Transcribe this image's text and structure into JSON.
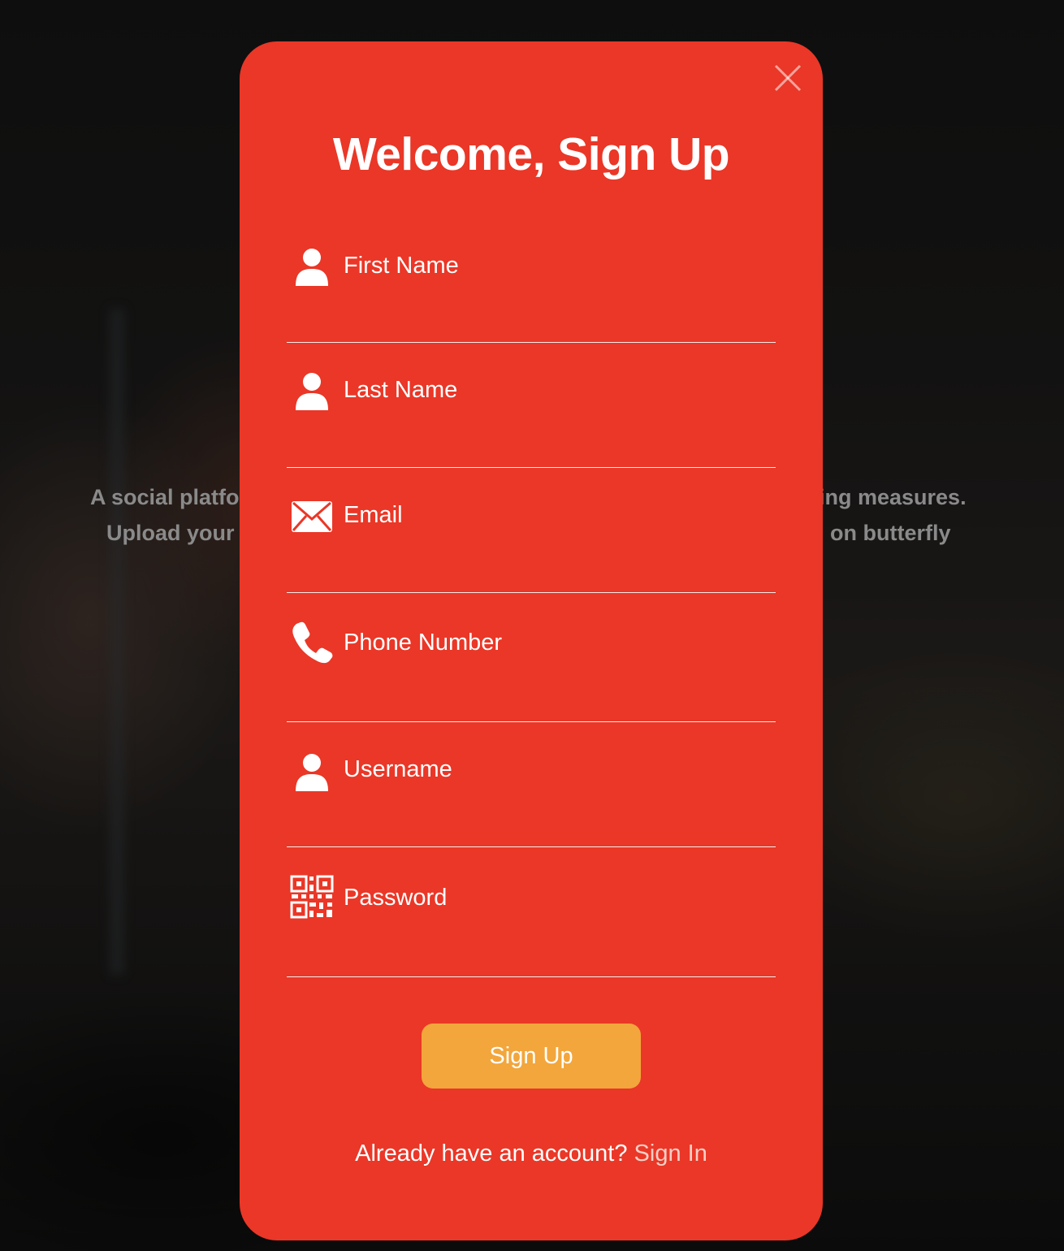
{
  "background": {
    "tagline_line1_left": "A social platfo",
    "tagline_line1_right": "ing measures.",
    "tagline_line2_left": "Upload your",
    "tagline_line2_right": "on butterfly"
  },
  "modal": {
    "title": "Welcome, Sign Up",
    "close_icon": "close-icon",
    "fields": [
      {
        "placeholder": "First Name",
        "value": "",
        "icon": "user-icon"
      },
      {
        "placeholder": "Last Name",
        "value": "",
        "icon": "user-icon"
      },
      {
        "placeholder": "Email",
        "value": "",
        "icon": "envelope-icon"
      },
      {
        "placeholder": "Phone Number",
        "value": "",
        "icon": "phone-icon"
      },
      {
        "placeholder": "Username",
        "value": "",
        "icon": "user-icon"
      },
      {
        "placeholder": "Password",
        "value": "",
        "icon": "qr-code-icon"
      }
    ],
    "submit_label": "Sign Up",
    "footer_prompt": "Already have an account?",
    "footer_link": "Sign In"
  },
  "colors": {
    "modal_background": "#ea3727",
    "button_background": "#f2a63c",
    "link_color": "#f6cfc6",
    "text": "#ffffff"
  }
}
